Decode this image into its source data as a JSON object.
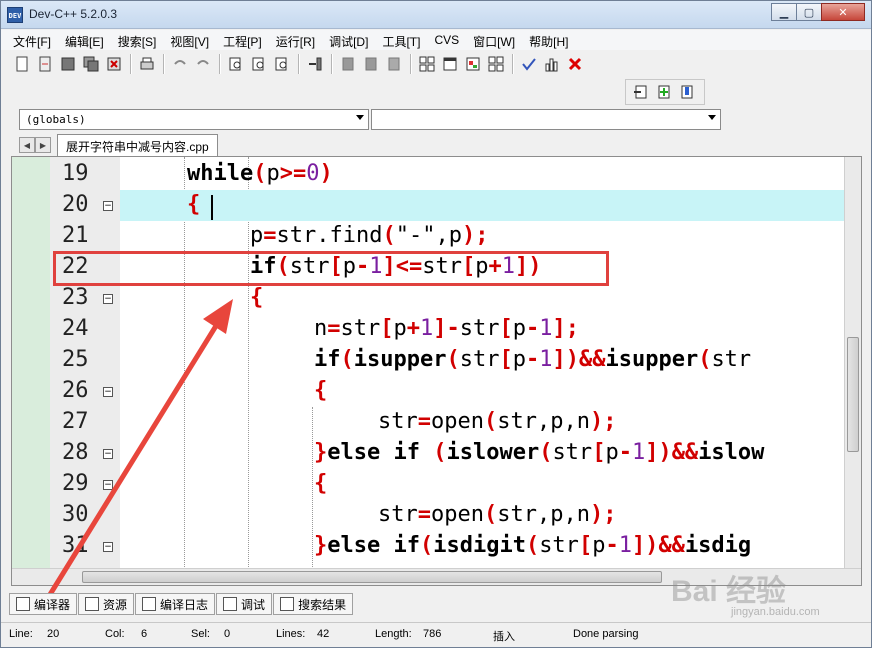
{
  "window": {
    "title": "Dev-C++ 5.2.0.3",
    "icon_text": "DEV"
  },
  "menu": [
    "文件[F]",
    "编辑[E]",
    "搜索[S]",
    "视图[V]",
    "工程[P]",
    "运行[R]",
    "调试[D]",
    "工具[T]",
    "CVS",
    "窗口[W]",
    "帮助[H]"
  ],
  "combos": {
    "scope": "(globals)",
    "symbol": ""
  },
  "file_tab": "展开字符串中减号内容.cpp",
  "lines": [
    {
      "num": "19",
      "fold": ""
    },
    {
      "num": "20",
      "fold": "−"
    },
    {
      "num": "21",
      "fold": ""
    },
    {
      "num": "22",
      "fold": ""
    },
    {
      "num": "23",
      "fold": "−"
    },
    {
      "num": "24",
      "fold": ""
    },
    {
      "num": "25",
      "fold": ""
    },
    {
      "num": "26",
      "fold": "−"
    },
    {
      "num": "27",
      "fold": ""
    },
    {
      "num": "28",
      "fold": "−"
    },
    {
      "num": "29",
      "fold": "−"
    },
    {
      "num": "30",
      "fold": ""
    },
    {
      "num": "31",
      "fold": "−"
    }
  ],
  "code": {
    "l19": {
      "kw": "while",
      "p1": "(",
      "v": "p",
      "op": ">=",
      "n": "0",
      "p2": ")"
    },
    "l20": {
      "brace": "{"
    },
    "l21": {
      "a": "p",
      "eq": "=",
      "b": "str.find",
      "p1": "(",
      "s": "\"-\"",
      "c": ",p",
      "p2": ")",
      "semi": ";"
    },
    "l22": {
      "kw": "if",
      "p1": "(",
      "a": "str",
      "b1": "[",
      "v1": "p",
      "m": "-",
      "n1": "1",
      "b2": "]",
      "op": "<=",
      "c": "str",
      "b3": "[",
      "v2": "p",
      "pl": "+",
      "n2": "1",
      "b4": "])"
    },
    "l23": {
      "brace": "{"
    },
    "l24": {
      "a": "n",
      "eq": "=",
      "b": "str",
      "b1": "[",
      "v1": "p",
      "pl": "+",
      "n1": "1",
      "b2": "]",
      "m": "-",
      "c": "str",
      "b3": "[",
      "v2": "p",
      "m2": "-",
      "n2": "1",
      "b4": "];"
    },
    "l25": {
      "kw": "if",
      "p1": "((",
      "f": "isupper",
      "p2": "(",
      "a": "str",
      "b1": "[",
      "v": "p",
      "m": "-",
      "n": "1",
      "b2": "])",
      "and": "&&",
      "f2": "isupper",
      "p3": "(",
      "t": "str"
    },
    "l26": {
      "brace": "{"
    },
    "l27": {
      "a": "str",
      "eq": "=",
      "f": "open",
      "p1": "(",
      "args": "str,p,n",
      "p2": ")",
      "semi": ";"
    },
    "l28": {
      "brace": "}",
      "kw": "else if",
      "p1": "(",
      "f": "islower",
      "p2": "(",
      "a": "str",
      "b1": "[",
      "v": "p",
      "m": "-",
      "n": "1",
      "b2": "])",
      "and": "&&",
      "t": "islow"
    },
    "l29": {
      "brace": "{"
    },
    "l30": {
      "a": "str",
      "eq": "=",
      "f": "open",
      "p1": "(",
      "args": "str,p,n",
      "p2": ")",
      "semi": ";"
    },
    "l31": {
      "brace": "}",
      "kw": "else if",
      "p1": "(",
      "f": "isdigit",
      "p2": "(",
      "a": "str",
      "b1": "[",
      "v": "p",
      "m": "-",
      "n": "1",
      "b2": "])",
      "and": "&&",
      "t": "isdig"
    }
  },
  "bottom_tabs": [
    "编译器",
    "资源",
    "编译日志",
    "调试",
    "搜索结果"
  ],
  "status": {
    "line_label": "Line:",
    "line": "20",
    "col_label": "Col:",
    "col": "6",
    "sel_label": "Sel:",
    "sel": "0",
    "lines_label": "Lines:",
    "lines": "42",
    "length_label": "Length:",
    "length": "786",
    "mode": "插入",
    "message": "Done parsing"
  },
  "watermark": {
    "text": "Bai 经验",
    "sub": "jingyan.baidu.com"
  },
  "colors": {
    "operator": "#d10000",
    "number": "#7a1fa0",
    "active_line": "#c8f4f7",
    "highlight_box": "#e0413e"
  }
}
